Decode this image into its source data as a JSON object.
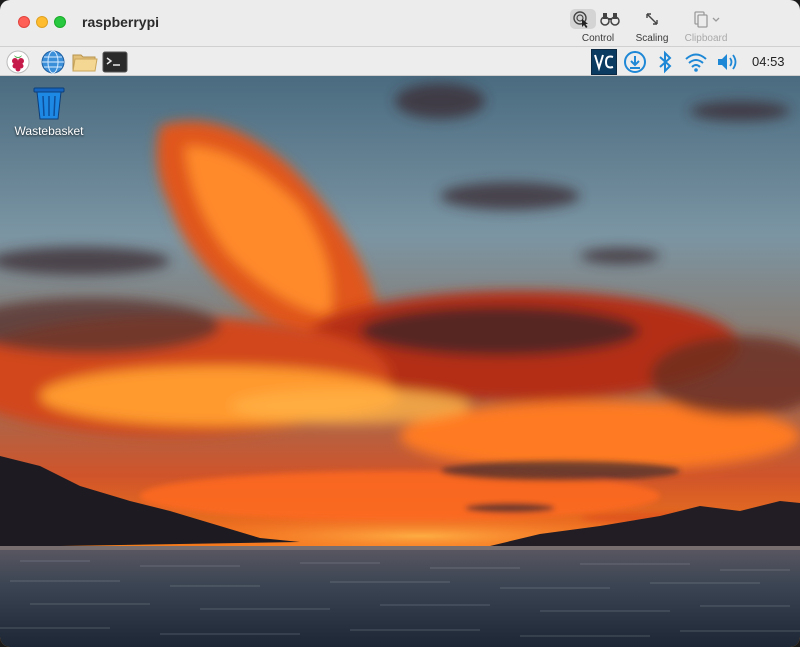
{
  "window": {
    "title": "raspberrypi"
  },
  "toolbar": {
    "control_label": "Control",
    "scaling_label": "Scaling",
    "clipboard_label": "Clipboard"
  },
  "panel": {
    "clock": "04:53",
    "icons": [
      "raspberry-menu-icon",
      "web-browser-icon",
      "file-manager-icon",
      "terminal-icon",
      "vnc-server-icon",
      "updater-icon",
      "bluetooth-icon",
      "wifi-icon",
      "volume-icon"
    ]
  },
  "desktop": {
    "icons": [
      {
        "label": "Wastebasket",
        "icon": "trash-icon"
      }
    ]
  },
  "colors": {
    "titlebar": "#ececec",
    "panel": "#ededed",
    "vnc_accent": "#0a6ebd",
    "system_icon_blue": "#1e88d6"
  }
}
